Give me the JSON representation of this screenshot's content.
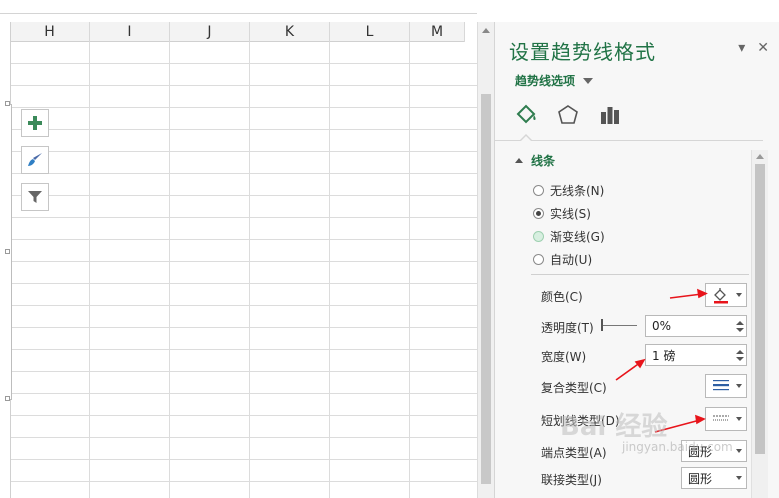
{
  "sheet": {
    "columns": [
      "H",
      "I",
      "J",
      "K",
      "L",
      "M"
    ]
  },
  "pane": {
    "title": "设置趋势线格式",
    "dropdown_label": "趋势线选项",
    "section_title": "线条",
    "radios": [
      {
        "label": "无线条(N)",
        "checked": false
      },
      {
        "label": "实线(S)",
        "checked": true
      },
      {
        "label": "渐变线(G)",
        "checked": false
      },
      {
        "label": "自动(U)",
        "checked": false
      }
    ],
    "properties": {
      "color_label": "颜色(C)",
      "transparency_label": "透明度(T)",
      "transparency_value": "0%",
      "width_label": "宽度(W)",
      "width_value": "1 磅",
      "compound_label": "复合类型(C)",
      "dash_label": "短划线类型(D)",
      "cap_label": "端点类型(A)",
      "cap_value": "圆形",
      "join_label": "联接类型(J)",
      "join_value": "圆形"
    }
  },
  "watermark": {
    "brand": "Bai 经验",
    "site": "jingyan.baidu.com"
  },
  "colors": {
    "accent_green": "#217346",
    "annotation_red": "#e8141b"
  }
}
